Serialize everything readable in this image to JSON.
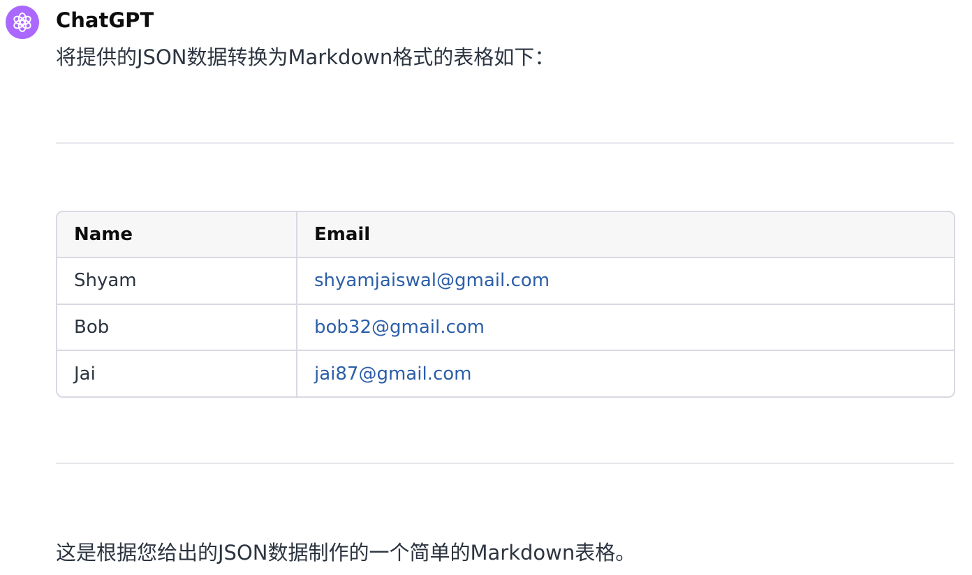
{
  "message": {
    "author": "ChatGPT",
    "avatar_icon": "openai-logo-icon",
    "avatar_color": "#ab68ff",
    "intro": "将提供的JSON数据转换为Markdown格式的表格如下：",
    "table": {
      "headers": [
        "Name",
        "Email"
      ],
      "rows": [
        {
          "name": "Shyam",
          "email": "shyamjaiswal@gmail.com"
        },
        {
          "name": "Bob",
          "email": "bob32@gmail.com"
        },
        {
          "name": "Jai",
          "email": "jai87@gmail.com"
        }
      ]
    },
    "outro": "这是根据您给出的JSON数据制作的一个简单的Markdown表格。"
  },
  "colors": {
    "link": "#2b5ea8",
    "text": "#2c3440",
    "border": "#d9d9e3",
    "header_bg": "#f7f7f8"
  }
}
